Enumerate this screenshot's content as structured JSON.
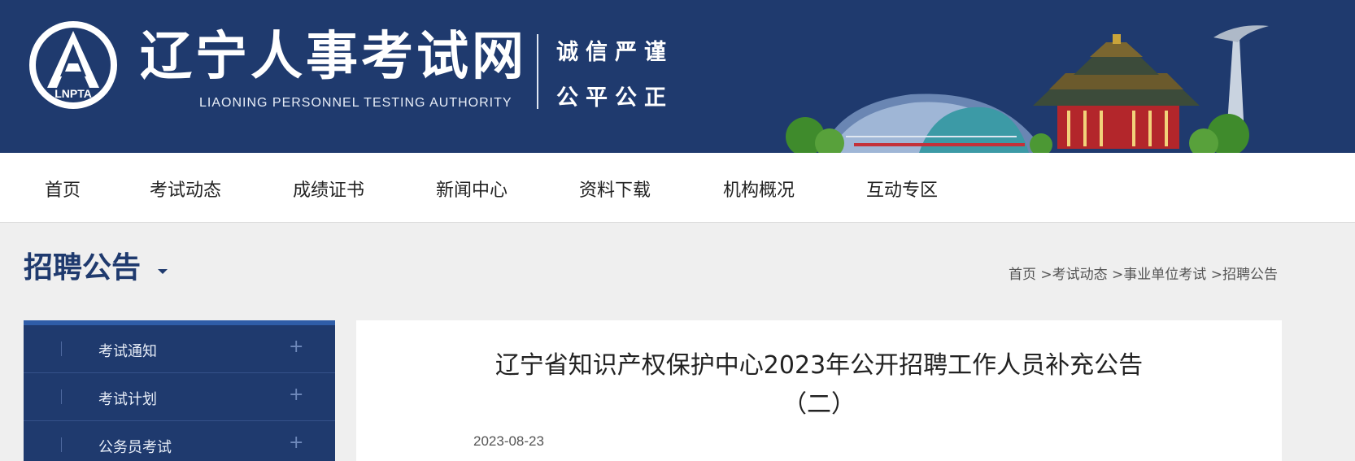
{
  "header": {
    "logo_text": "LNPTA",
    "site_title": "辽宁人事考试网",
    "site_subtitle": "LIAONING PERSONNEL TESTING AUTHORITY",
    "slogan_line1": "诚信严谨",
    "slogan_line2": "公平公正"
  },
  "nav": {
    "items": [
      "首页",
      "考试动态",
      "成绩证书",
      "新闻中心",
      "资料下载",
      "机构概况",
      "互动专区"
    ]
  },
  "page": {
    "title": "招聘公告",
    "breadcrumb": [
      "首页",
      " >考试动态",
      " >事业单位考试",
      " >招聘公告"
    ]
  },
  "sidebar": {
    "items": [
      {
        "label": "考试通知",
        "icon": "plus-icon"
      },
      {
        "label": "考试计划",
        "icon": "plus-icon"
      },
      {
        "label": "公务员考试",
        "icon": "plus-icon"
      }
    ]
  },
  "article": {
    "title": "辽宁省知识产权保护中心2023年公开招聘工作人员补充公告（二）",
    "date": "2023-08-23"
  },
  "colors": {
    "brand_navy": "#1f3a6e",
    "sidebar_accent": "#2f5da8",
    "page_bg": "#efefef"
  }
}
